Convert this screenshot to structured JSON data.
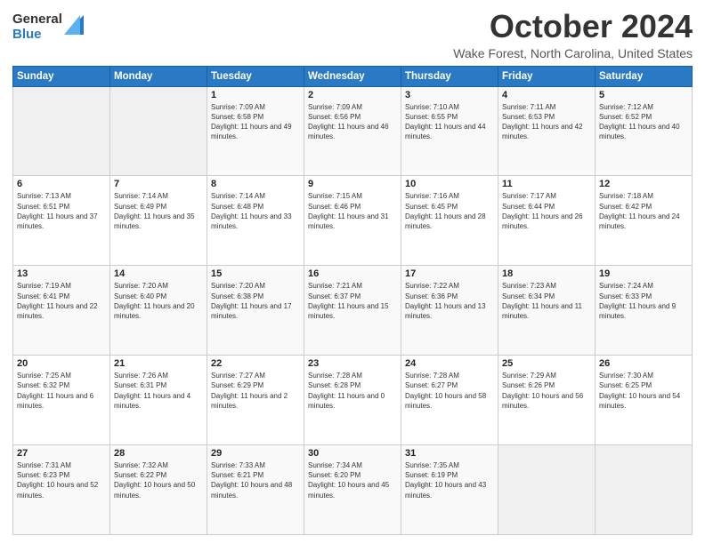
{
  "logo": {
    "general": "General",
    "blue": "Blue"
  },
  "header": {
    "month": "October 2024",
    "location": "Wake Forest, North Carolina, United States"
  },
  "weekdays": [
    "Sunday",
    "Monday",
    "Tuesday",
    "Wednesday",
    "Thursday",
    "Friday",
    "Saturday"
  ],
  "weeks": [
    [
      {
        "day": "",
        "sunrise": "",
        "sunset": "",
        "daylight": "",
        "empty": true
      },
      {
        "day": "",
        "sunrise": "",
        "sunset": "",
        "daylight": "",
        "empty": true
      },
      {
        "day": "1",
        "sunrise": "Sunrise: 7:09 AM",
        "sunset": "Sunset: 6:58 PM",
        "daylight": "Daylight: 11 hours and 49 minutes."
      },
      {
        "day": "2",
        "sunrise": "Sunrise: 7:09 AM",
        "sunset": "Sunset: 6:56 PM",
        "daylight": "Daylight: 11 hours and 46 minutes."
      },
      {
        "day": "3",
        "sunrise": "Sunrise: 7:10 AM",
        "sunset": "Sunset: 6:55 PM",
        "daylight": "Daylight: 11 hours and 44 minutes."
      },
      {
        "day": "4",
        "sunrise": "Sunrise: 7:11 AM",
        "sunset": "Sunset: 6:53 PM",
        "daylight": "Daylight: 11 hours and 42 minutes."
      },
      {
        "day": "5",
        "sunrise": "Sunrise: 7:12 AM",
        "sunset": "Sunset: 6:52 PM",
        "daylight": "Daylight: 11 hours and 40 minutes."
      }
    ],
    [
      {
        "day": "6",
        "sunrise": "Sunrise: 7:13 AM",
        "sunset": "Sunset: 6:51 PM",
        "daylight": "Daylight: 11 hours and 37 minutes."
      },
      {
        "day": "7",
        "sunrise": "Sunrise: 7:14 AM",
        "sunset": "Sunset: 6:49 PM",
        "daylight": "Daylight: 11 hours and 35 minutes."
      },
      {
        "day": "8",
        "sunrise": "Sunrise: 7:14 AM",
        "sunset": "Sunset: 6:48 PM",
        "daylight": "Daylight: 11 hours and 33 minutes."
      },
      {
        "day": "9",
        "sunrise": "Sunrise: 7:15 AM",
        "sunset": "Sunset: 6:46 PM",
        "daylight": "Daylight: 11 hours and 31 minutes."
      },
      {
        "day": "10",
        "sunrise": "Sunrise: 7:16 AM",
        "sunset": "Sunset: 6:45 PM",
        "daylight": "Daylight: 11 hours and 28 minutes."
      },
      {
        "day": "11",
        "sunrise": "Sunrise: 7:17 AM",
        "sunset": "Sunset: 6:44 PM",
        "daylight": "Daylight: 11 hours and 26 minutes."
      },
      {
        "day": "12",
        "sunrise": "Sunrise: 7:18 AM",
        "sunset": "Sunset: 6:42 PM",
        "daylight": "Daylight: 11 hours and 24 minutes."
      }
    ],
    [
      {
        "day": "13",
        "sunrise": "Sunrise: 7:19 AM",
        "sunset": "Sunset: 6:41 PM",
        "daylight": "Daylight: 11 hours and 22 minutes."
      },
      {
        "day": "14",
        "sunrise": "Sunrise: 7:20 AM",
        "sunset": "Sunset: 6:40 PM",
        "daylight": "Daylight: 11 hours and 20 minutes."
      },
      {
        "day": "15",
        "sunrise": "Sunrise: 7:20 AM",
        "sunset": "Sunset: 6:38 PM",
        "daylight": "Daylight: 11 hours and 17 minutes."
      },
      {
        "day": "16",
        "sunrise": "Sunrise: 7:21 AM",
        "sunset": "Sunset: 6:37 PM",
        "daylight": "Daylight: 11 hours and 15 minutes."
      },
      {
        "day": "17",
        "sunrise": "Sunrise: 7:22 AM",
        "sunset": "Sunset: 6:36 PM",
        "daylight": "Daylight: 11 hours and 13 minutes."
      },
      {
        "day": "18",
        "sunrise": "Sunrise: 7:23 AM",
        "sunset": "Sunset: 6:34 PM",
        "daylight": "Daylight: 11 hours and 11 minutes."
      },
      {
        "day": "19",
        "sunrise": "Sunrise: 7:24 AM",
        "sunset": "Sunset: 6:33 PM",
        "daylight": "Daylight: 11 hours and 9 minutes."
      }
    ],
    [
      {
        "day": "20",
        "sunrise": "Sunrise: 7:25 AM",
        "sunset": "Sunset: 6:32 PM",
        "daylight": "Daylight: 11 hours and 6 minutes."
      },
      {
        "day": "21",
        "sunrise": "Sunrise: 7:26 AM",
        "sunset": "Sunset: 6:31 PM",
        "daylight": "Daylight: 11 hours and 4 minutes."
      },
      {
        "day": "22",
        "sunrise": "Sunrise: 7:27 AM",
        "sunset": "Sunset: 6:29 PM",
        "daylight": "Daylight: 11 hours and 2 minutes."
      },
      {
        "day": "23",
        "sunrise": "Sunrise: 7:28 AM",
        "sunset": "Sunset: 6:28 PM",
        "daylight": "Daylight: 11 hours and 0 minutes."
      },
      {
        "day": "24",
        "sunrise": "Sunrise: 7:28 AM",
        "sunset": "Sunset: 6:27 PM",
        "daylight": "Daylight: 10 hours and 58 minutes."
      },
      {
        "day": "25",
        "sunrise": "Sunrise: 7:29 AM",
        "sunset": "Sunset: 6:26 PM",
        "daylight": "Daylight: 10 hours and 56 minutes."
      },
      {
        "day": "26",
        "sunrise": "Sunrise: 7:30 AM",
        "sunset": "Sunset: 6:25 PM",
        "daylight": "Daylight: 10 hours and 54 minutes."
      }
    ],
    [
      {
        "day": "27",
        "sunrise": "Sunrise: 7:31 AM",
        "sunset": "Sunset: 6:23 PM",
        "daylight": "Daylight: 10 hours and 52 minutes."
      },
      {
        "day": "28",
        "sunrise": "Sunrise: 7:32 AM",
        "sunset": "Sunset: 6:22 PM",
        "daylight": "Daylight: 10 hours and 50 minutes."
      },
      {
        "day": "29",
        "sunrise": "Sunrise: 7:33 AM",
        "sunset": "Sunset: 6:21 PM",
        "daylight": "Daylight: 10 hours and 48 minutes."
      },
      {
        "day": "30",
        "sunrise": "Sunrise: 7:34 AM",
        "sunset": "Sunset: 6:20 PM",
        "daylight": "Daylight: 10 hours and 45 minutes."
      },
      {
        "day": "31",
        "sunrise": "Sunrise: 7:35 AM",
        "sunset": "Sunset: 6:19 PM",
        "daylight": "Daylight: 10 hours and 43 minutes."
      },
      {
        "day": "",
        "sunrise": "",
        "sunset": "",
        "daylight": "",
        "empty": true
      },
      {
        "day": "",
        "sunrise": "",
        "sunset": "",
        "daylight": "",
        "empty": true
      }
    ]
  ]
}
